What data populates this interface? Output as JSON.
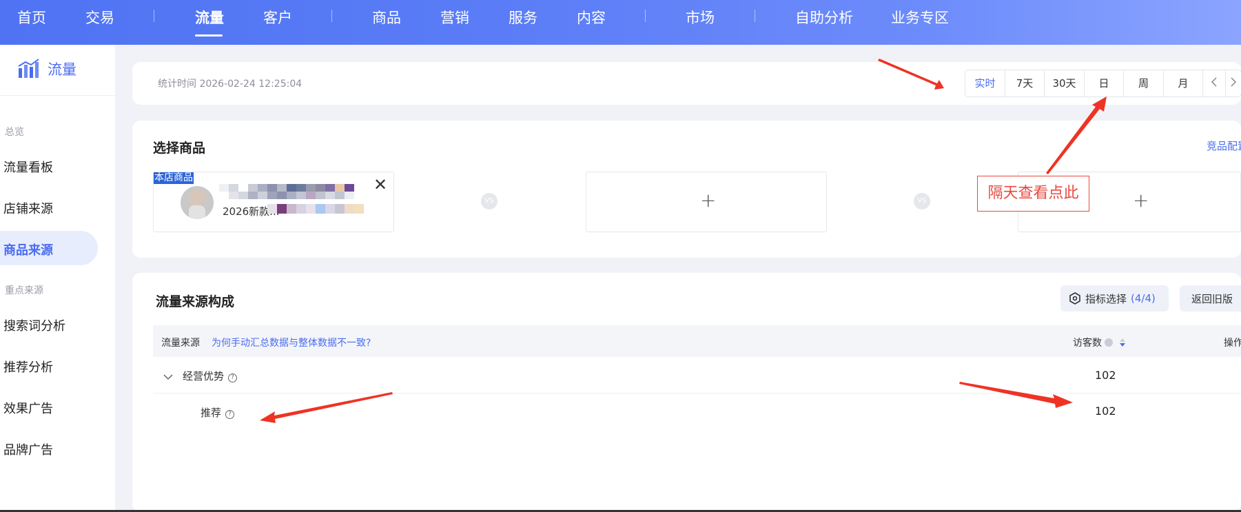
{
  "top_nav": {
    "items": [
      "首页",
      "交易",
      "流量",
      "客户",
      "商品",
      "营销",
      "服务",
      "内容",
      "市场",
      "自助分析",
      "业务专区"
    ],
    "active": "流量"
  },
  "sidebar": {
    "title": "流量",
    "groups": [
      {
        "label": "总览",
        "items": [
          "流量看板",
          "店铺来源",
          "商品来源"
        ]
      },
      {
        "label": "重点来源",
        "items": [
          "搜索词分析",
          "推荐分析",
          "效果广告",
          "品牌广告"
        ]
      }
    ],
    "active_item": "商品来源"
  },
  "stats_bar": {
    "time_label": "统计时间 2026-02-24 12:25:04",
    "ranges": [
      "实时",
      "7天",
      "30天",
      "日",
      "周",
      "月"
    ],
    "active_range": "实时",
    "prev_icon": "chevron-left-icon",
    "next_icon": "chevron-right-icon"
  },
  "select_product": {
    "title": "选择商品",
    "config_link": "竞品配置",
    "own_tag": "本店商品",
    "product_name": "2026新款...",
    "vs_label": "VS",
    "add_symbol": "+"
  },
  "annotation": {
    "text": "隔天查看点此",
    "color": "#e84a3f"
  },
  "traffic": {
    "title": "流量来源构成",
    "metric_button": {
      "label": "指标选择",
      "count": "(4/4)"
    },
    "back_button": "返回旧版",
    "headers": {
      "source": "流量来源",
      "help_link": "为何手动汇总数据与整体数据不一致?",
      "visitors": "访客数",
      "ops": "操作"
    },
    "rows": [
      {
        "label": "经营优势",
        "visitors": "102"
      },
      {
        "label": "推荐",
        "visitors": "102"
      }
    ]
  },
  "colors": {
    "brand": "#4a6cf1",
    "annotation_red": "#e84a3f"
  }
}
